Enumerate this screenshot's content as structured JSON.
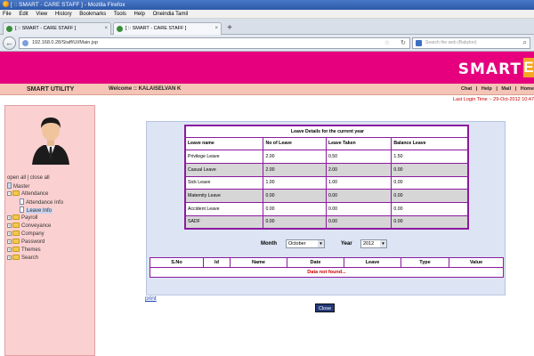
{
  "window": {
    "title": "[ :: SMART - CARE STAFF ] - Mozilla Firefox"
  },
  "menu": [
    "File",
    "Edit",
    "View",
    "History",
    "Bookmarks",
    "Tools",
    "Help",
    "Oneindia Tamil"
  ],
  "tabs": [
    {
      "label": "[ :: SMART - CARE STAFF ]"
    },
    {
      "label": "[ :: SMART - CARE STAFF ]"
    }
  ],
  "nav": {
    "url": "192.168.0.28/Staff/UI/Main.jsp",
    "search_placeholder": "Search the web (Babylon)"
  },
  "header": {
    "logo": "SMART",
    "logo_tail": "E",
    "utility": "SMART UTILITY",
    "welcome": "Welcome :: KALAISELVAN K",
    "links": [
      "Chat",
      "|",
      "Help",
      "|",
      "Mail",
      "|",
      "Home"
    ],
    "last_login": "Last Login Time :- 29-Oct-2012 10:47"
  },
  "sidebar": {
    "open_all": "open all | close all",
    "tree": {
      "root": "Master",
      "attendance": "Attendance",
      "attendance_info": "Attendance Info",
      "leave_info": "Leave Info",
      "payroll": "Payroll",
      "conveyance": "Conveyance",
      "company": "Company",
      "password": "Password",
      "themes": "Themes",
      "search": "Search"
    }
  },
  "leave": {
    "title": "Leave Details for the current year",
    "headers": [
      "Leave name",
      "No of Leave",
      "Leave Taken",
      "Balance Leave"
    ],
    "rows": [
      [
        "Privilege Leave",
        "2.00",
        "0.50",
        "1.50"
      ],
      [
        "Casual Leave",
        "2.00",
        "2.00",
        "0.00"
      ],
      [
        "Sick Leave",
        "1.00",
        "1.00",
        "0.00"
      ],
      [
        "Maternity Leave",
        "0.00",
        "0.00",
        "0.00"
      ],
      [
        "Accident Leave",
        "0.00",
        "0.00",
        "0.00"
      ],
      [
        "SADF",
        "0.00",
        "0.00",
        "0.00"
      ]
    ]
  },
  "filters": {
    "month_label": "Month",
    "month_value": "October",
    "year_label": "Year",
    "year_value": "2012"
  },
  "records": {
    "headers": [
      "S.No",
      "Id",
      "Name",
      "Date",
      "Leave",
      "Type",
      "Value"
    ],
    "empty_message": "Data not found..."
  },
  "actions": {
    "print": "print",
    "close": "Close"
  }
}
